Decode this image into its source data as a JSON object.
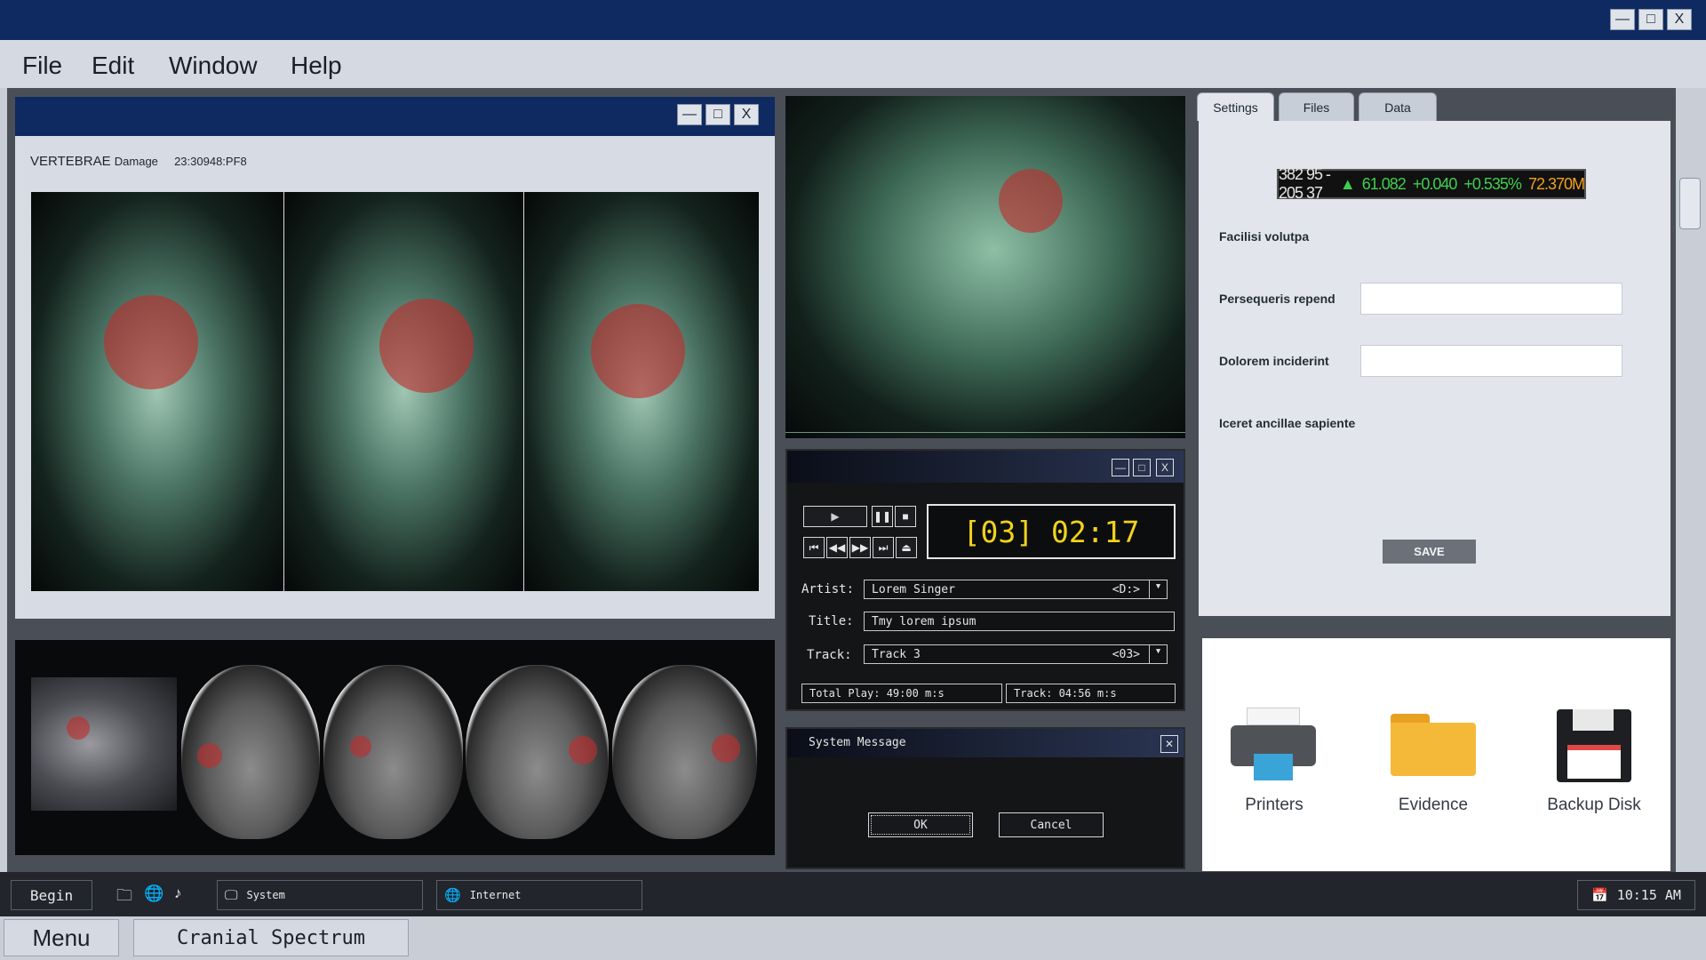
{
  "window": {
    "controls": {
      "minimize": "—",
      "maximize": "□",
      "close": "X"
    }
  },
  "menu": {
    "items": [
      "File",
      "Edit",
      "Window",
      "Help"
    ]
  },
  "vertebrae_window": {
    "title_main": "VERTEBRAE",
    "title_sub": "Damage",
    "code": "23:30948:PF8",
    "controls": {
      "minimize": "—",
      "maximize": "□",
      "close": "X"
    }
  },
  "player": {
    "display": "[03] 02:17",
    "artist_label": "Artist:",
    "artist_value": "Lorem Singer",
    "artist_drive": "<D:>",
    "title_label": "Title:",
    "title_value": "Tmy lorem ipsum",
    "track_label": "Track:",
    "track_value": "Track 3",
    "track_num": "<03>",
    "total_play": "Total Play: 49:00 m:s",
    "track_time": "Track: 04:56 m:s"
  },
  "system_message": {
    "title": "System Message",
    "ok": "OK",
    "cancel": "Cancel"
  },
  "settings": {
    "tabs": [
      "Settings",
      "Files",
      "Data"
    ],
    "ticker": {
      "pair": "382 95 - 205 37",
      "v1": "61.082",
      "v2": "+0.040",
      "v3": "+0.535%",
      "v4": "72.370M"
    },
    "labels": [
      "Facilisi volutpa",
      "Persequeris repend",
      "Dolorem inciderint",
      "Iceret ancillae sapiente"
    ],
    "save": "SAVE"
  },
  "icons": {
    "printers": "Printers",
    "evidence": "Evidence",
    "backup": "Backup Disk"
  },
  "taskbar": {
    "begin": "Begin",
    "system": "System",
    "internet": "Internet",
    "clock": "10:15 AM"
  },
  "bottom": {
    "menu": "Menu",
    "app": "Cranial Spectrum"
  },
  "colors": {
    "titlebar": "#0e2a60",
    "display_text": "#f0d21c",
    "ticker_green": "#3fcf4f",
    "ticker_orange": "#f0a020"
  }
}
